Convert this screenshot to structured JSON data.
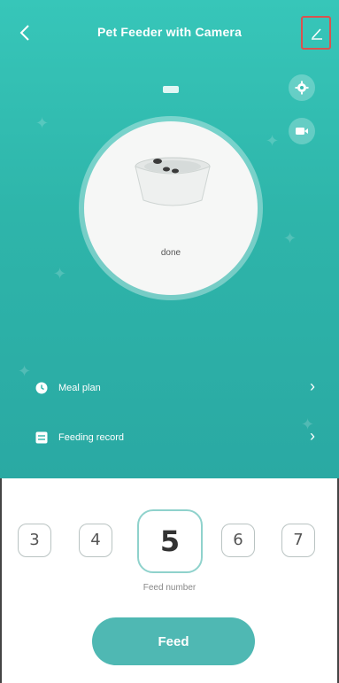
{
  "header": {
    "back_icon": "chevron-left-icon",
    "title": "Pet Feeder with Camera",
    "edit_icon": "pencil-icon"
  },
  "device": {
    "battery_icon": "battery-icon",
    "settings_icon": "gear-icon",
    "camera_icon": "video-camera-icon",
    "status": "done"
  },
  "menu": {
    "items": [
      {
        "label": "Meal plan",
        "icon": "clock-icon"
      },
      {
        "label": "Feeding record",
        "icon": "list-icon"
      }
    ]
  },
  "feed": {
    "numbers": [
      "3",
      "4",
      "5",
      "6",
      "7"
    ],
    "selected": "5",
    "label": "Feed number",
    "button_label": "Feed"
  },
  "colors": {
    "accent": "#2eb5aa",
    "button": "#4fb8b3",
    "edit_highlight": "#d9534f"
  }
}
